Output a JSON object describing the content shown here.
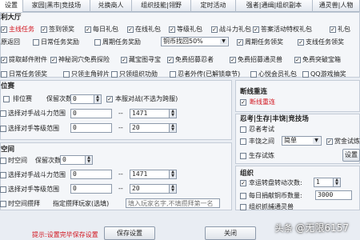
{
  "tabs": [
    "设置",
    "家园|黑市|竞技场",
    "兑换商人",
    "组织技能|翎野",
    "定时活动",
    "强者|通缉|组织副本",
    "通灵兽|人物"
  ],
  "daily": {
    "title": "利大厅",
    "rows": [
      [
        "主线任务",
        "签到领奖",
        "每日礼包",
        "在线礼包",
        "等级礼包",
        "战斗力礼包",
        "答案活动特权礼包",
        "礼包"
      ],
      [
        "原返回",
        "日常任务奖励",
        "周期任务奖励"
      ],
      [
        "提取邮件附件",
        "神秘洞穴免费探险",
        "藏宝图寻宝",
        "免费招募忍者",
        "免费招募通灵兽",
        "免费突破宝箱"
      ],
      [
        "日常任务领奖",
        "只领主角碎片",
        "只领组织功勋",
        "忍者外传(已解锁章节)",
        "心悦会员礼包",
        "QQ游戏抽奖"
      ]
    ],
    "row2_right": [
      "周期任务领奖",
      "支线任务领奖"
    ],
    "refresh_value": "铜币找回50%"
  },
  "rank": {
    "title": "位赛",
    "items": [
      "排位赛",
      "选择对手战斗力范围",
      "选择对手等级范围"
    ],
    "keep_label": "保留次数",
    "keep_value": "0",
    "local_battle": "本服对战(不选为跨服)",
    "power_from": "0",
    "power_to": "1471",
    "level_from": "0",
    "level_to": "20"
  },
  "time": {
    "title": "空间",
    "items": [
      "时空间",
      "选择对手战斗力范围",
      "选择对手等级范围",
      "时空间攒拜"
    ],
    "keep_label": "保留次数",
    "keep_value": "0",
    "power_from": "0",
    "power_to": "1471",
    "level_from": "0",
    "level_to": "20",
    "designate_label": "指定攒拜玩家(选填)",
    "designate_placeholder": "填入玩家名字,不填攒拜第一名"
  },
  "break": {
    "title": "断线重连",
    "item": "断线重连"
  },
  "ninja": {
    "title": "忍考|生存|丰饶|竞技场",
    "items": [
      "忍者考试",
      "丰饶之间",
      "生存试炼",
      "赏金试炼"
    ],
    "mode_value": "简单",
    "extra_button": "设置"
  },
  "org": {
    "title": "组织",
    "items": [
      "幸运转盘转动次数:",
      "每日捐献铜币数量:",
      "组织抓捕通灵兽"
    ],
    "spin_value": "1",
    "donate_value": "3000"
  },
  "footer": {
    "tip": "提示:设置完毕保存设置",
    "save": "保存设置",
    "close": "关闭"
  },
  "watermark": {
    "brand": "头条",
    "account": "@无限6157"
  }
}
